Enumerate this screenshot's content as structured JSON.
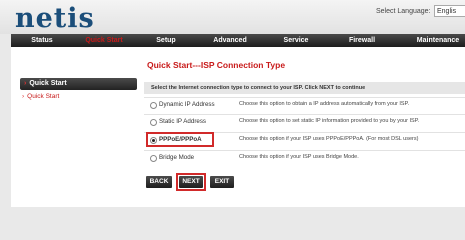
{
  "header": {
    "logo_text": "netis",
    "language_label": "Select Language:",
    "language_value": "Englis"
  },
  "nav": {
    "tabs": [
      {
        "label": "Status",
        "active": false
      },
      {
        "label": "Quick Start",
        "active": true
      },
      {
        "label": "Setup",
        "active": false
      },
      {
        "label": "Advanced",
        "active": false
      },
      {
        "label": "Service",
        "active": false
      },
      {
        "label": "Firewall",
        "active": false
      },
      {
        "label": "Maintenance",
        "active": false
      }
    ]
  },
  "sidebar": {
    "title": "Quick Start",
    "items": [
      {
        "label": "Quick Start"
      }
    ]
  },
  "main": {
    "title": "Quick Start---ISP Connection Type",
    "instruction": "Select the Internet connection type to connect to your ISP. Click NEXT to continue",
    "options": [
      {
        "label": "Dynamic IP Address",
        "description": "Choose this option to obtain a IP address automatically from your ISP.",
        "selected": false
      },
      {
        "label": "Static IP Address",
        "description": "Choose this option to set static IP information provided to you by your ISP.",
        "selected": false
      },
      {
        "label": "PPPoE/PPPoA",
        "description": "Choose this option if your ISP uses PPPoE/PPPoA. (For most DSL users)",
        "selected": true
      },
      {
        "label": "Bridge Mode",
        "description": "Choose this option if your ISP uses Bridge Mode.",
        "selected": false
      }
    ],
    "buttons": {
      "back": "BACK",
      "next": "NEXT",
      "exit": "EXIT"
    }
  },
  "colors": {
    "accent": "#c81a1a",
    "highlight": "#d12a2a",
    "nav_bg": "#2a2a2a"
  }
}
